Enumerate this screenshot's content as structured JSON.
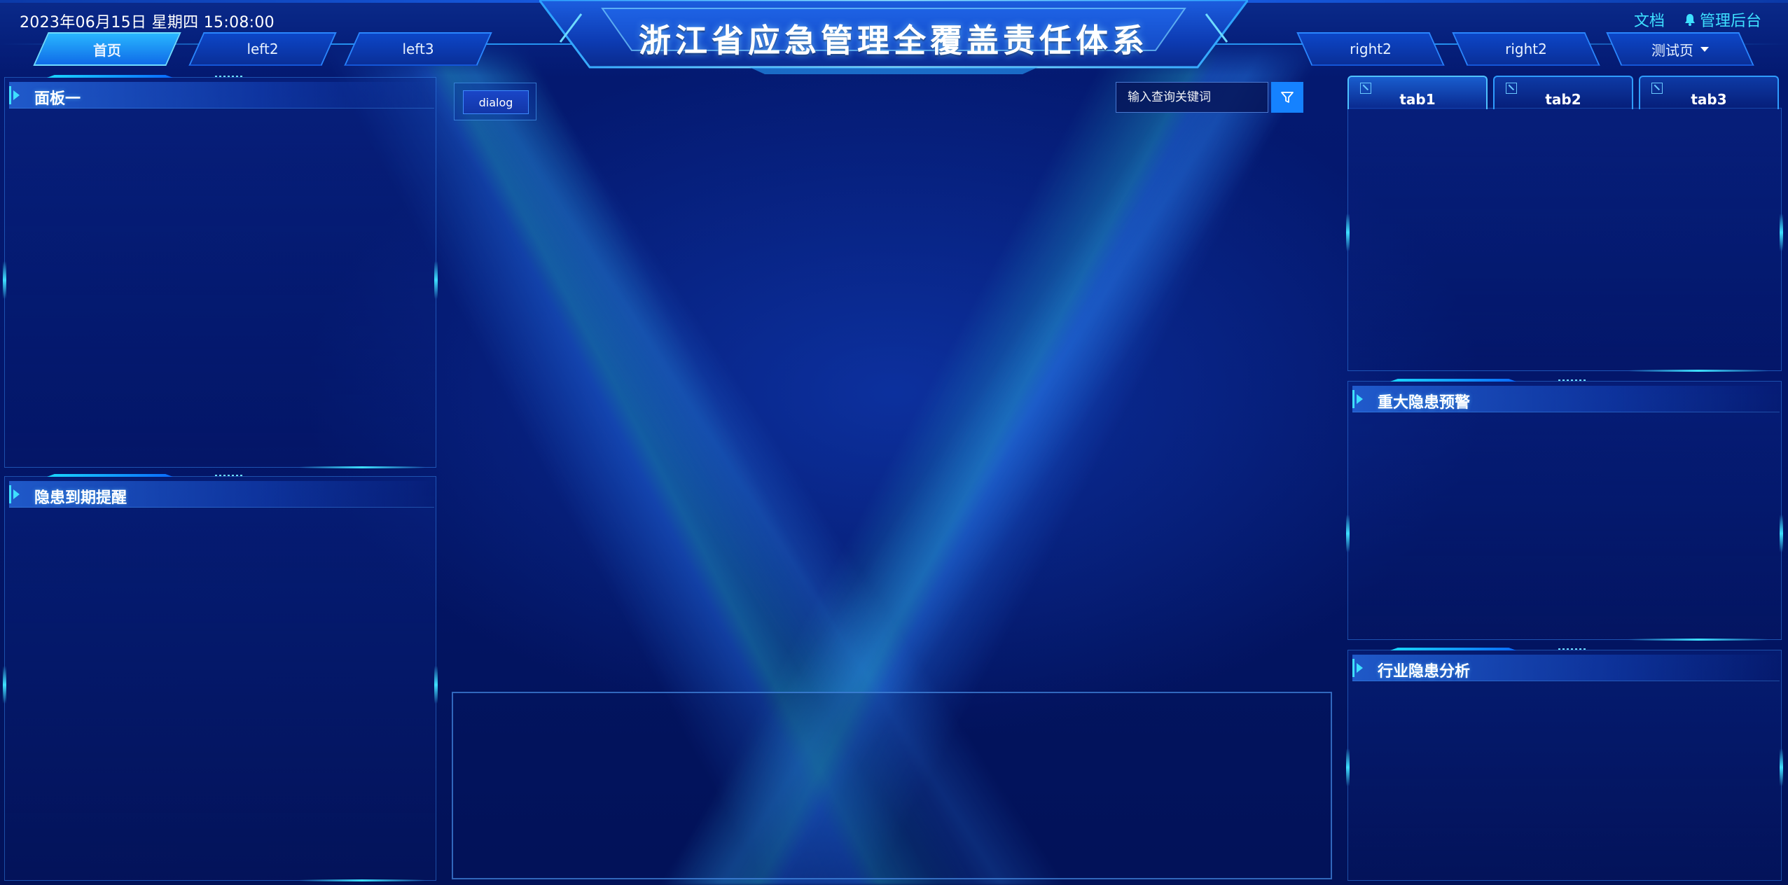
{
  "header": {
    "datetime": "2023年06月15日 星期四 15:08:00",
    "title": "浙江省应急管理全覆盖责任体系",
    "links": {
      "docs": "文档",
      "admin": "管理后台"
    },
    "nav_left": [
      "首页",
      "left2",
      "left3"
    ],
    "nav_right": [
      "right2",
      "right2",
      "测试页"
    ],
    "active_nav": "首页"
  },
  "left_panels": {
    "panel1_title": "面板一",
    "panel2_title": "隐患到期提醒"
  },
  "center": {
    "dialog_label": "dialog",
    "search_placeholder": "输入查询关键词"
  },
  "right_panels": {
    "tabs": [
      "tab1",
      "tab2",
      "tab3"
    ],
    "active_tab": "tab1",
    "panel2_title": "重大隐患预警",
    "panel3_title": "行业隐患分析"
  },
  "icons": {
    "bell": "bell-icon",
    "filter": "filter-icon",
    "tab": "expand-icon",
    "caret": "chevron-down-icon"
  },
  "colors": {
    "accent_cyan": "#3ee0ff",
    "primary_blue": "#1582ff",
    "background": "#03186a"
  }
}
